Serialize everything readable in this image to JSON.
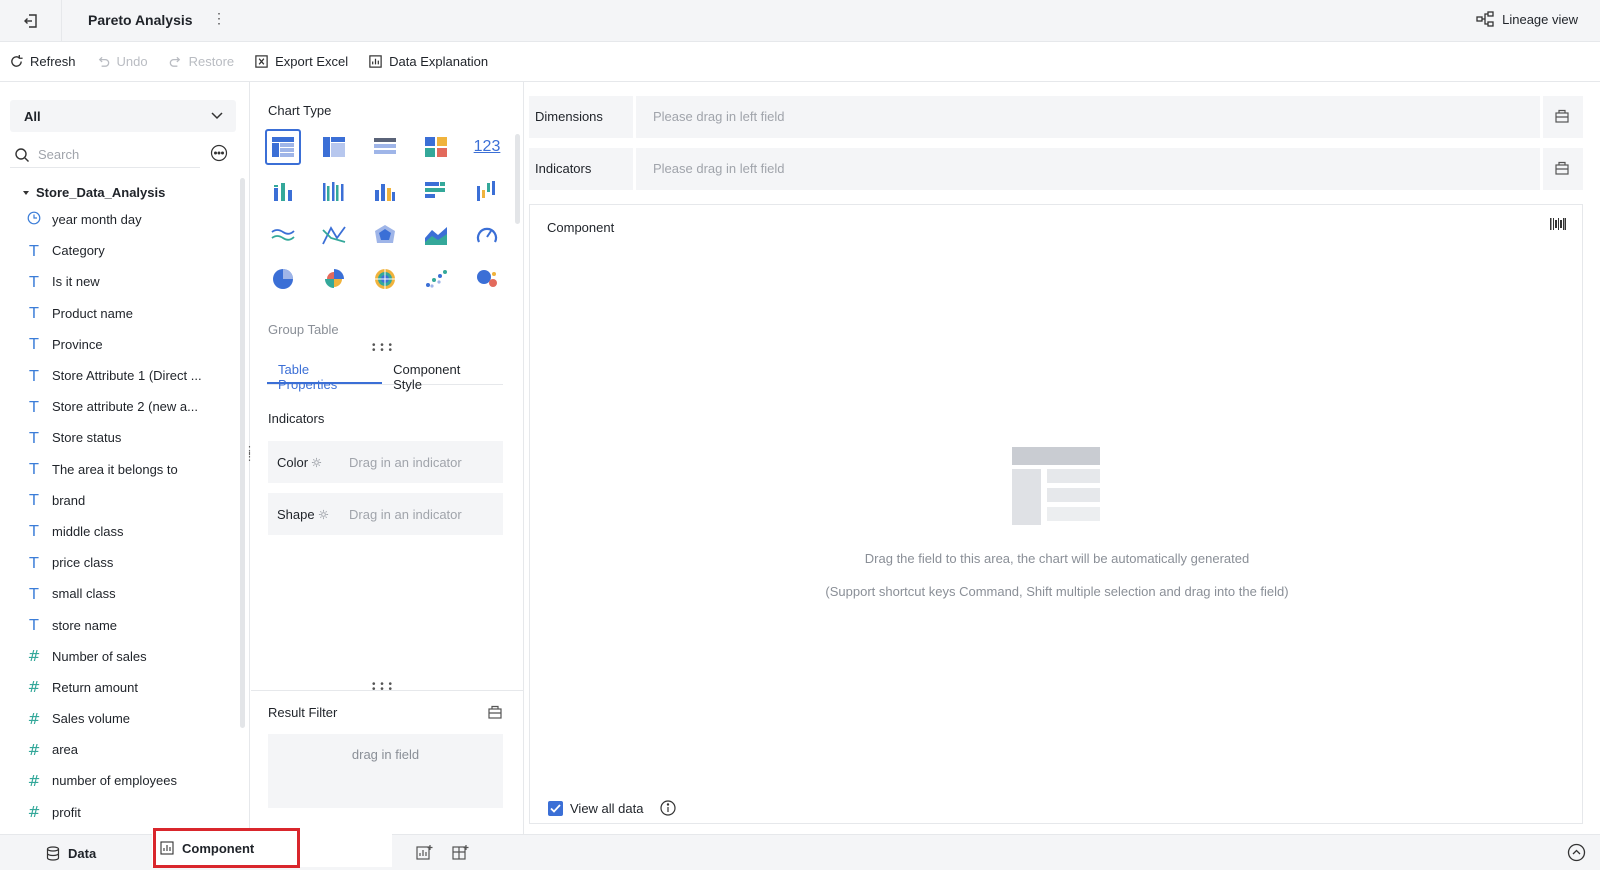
{
  "header": {
    "title": "Pareto Analysis",
    "more": "⋮",
    "lineage": "Lineage view"
  },
  "toolbar": {
    "refresh": "Refresh",
    "undo": "Undo",
    "restore": "Restore",
    "export_excel": "Export Excel",
    "data_explanation": "Data Explanation"
  },
  "left": {
    "scope": "All",
    "search_placeholder": "Search",
    "dataset": "Store_Data_Analysis",
    "fields": [
      {
        "name": "year month day",
        "type": "date"
      },
      {
        "name": "Category",
        "type": "text"
      },
      {
        "name": "Is it new",
        "type": "text"
      },
      {
        "name": "Product name",
        "type": "text"
      },
      {
        "name": "Province",
        "type": "text"
      },
      {
        "name": "Store Attribute 1 (Direct ...",
        "type": "text"
      },
      {
        "name": "Store attribute 2 (new a...",
        "type": "text"
      },
      {
        "name": "Store status",
        "type": "text"
      },
      {
        "name": "The area it belongs to",
        "type": "text"
      },
      {
        "name": "brand",
        "type": "text"
      },
      {
        "name": "middle class",
        "type": "text"
      },
      {
        "name": "price class",
        "type": "text"
      },
      {
        "name": "small class",
        "type": "text"
      },
      {
        "name": "store name",
        "type": "text"
      },
      {
        "name": "Number of sales",
        "type": "number"
      },
      {
        "name": "Return amount",
        "type": "number"
      },
      {
        "name": "Sales volume",
        "type": "number"
      },
      {
        "name": "area",
        "type": "number"
      },
      {
        "name": "number of employees",
        "type": "number"
      },
      {
        "name": "profit",
        "type": "number"
      }
    ]
  },
  "middle": {
    "chart_type_title": "Chart Type",
    "chart_type_123": "123",
    "selected_chart_name": "Group Table",
    "tabs": [
      "Table Properties",
      "Component Style"
    ],
    "indicators_title": "Indicators",
    "color_label": "Color",
    "shape_label": "Shape",
    "indicator_placeholder": "Drag in an indicator",
    "result_filter": "Result Filter",
    "filter_placeholder": "drag in field"
  },
  "right": {
    "dimensions_label": "Dimensions",
    "indicators_label": "Indicators",
    "drag_placeholder": "Please drag in left field",
    "component_title": "Component",
    "hint_line1": "Drag the field to this area, the chart will be automatically generated",
    "hint_line2": "(Support shortcut keys Command, Shift multiple selection and drag into the field)",
    "view_all": "View all data"
  },
  "bottom": {
    "data_tab": "Data",
    "component_tab": "Component"
  },
  "colors": {
    "accent": "#3b6fd6",
    "highlight": "#d9262c",
    "teal": "#34a89a"
  }
}
